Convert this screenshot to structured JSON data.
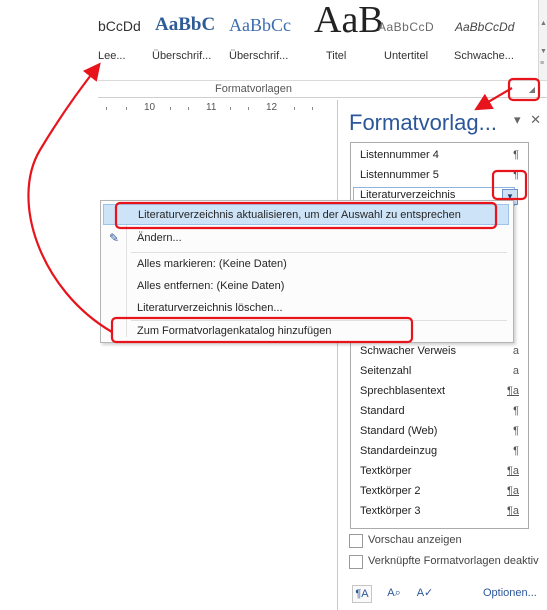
{
  "ribbon": {
    "styles": [
      {
        "preview": "bCcDd",
        "label": "Lee..."
      },
      {
        "preview": "AaBbC",
        "label": "Überschrif..."
      },
      {
        "preview": "AaBbCc",
        "label": "Überschrif..."
      },
      {
        "preview": "AaB",
        "label": "Titel"
      },
      {
        "preview": "AaBbCcD",
        "label": "Untertitel"
      },
      {
        "preview": "AaBbCcDd",
        "label": "Schwache..."
      }
    ],
    "group_label": "Formatvorlagen"
  },
  "ruler": {
    "ticks": [
      "10",
      "11",
      "12"
    ]
  },
  "pane": {
    "title": "Formatvorlag...",
    "styles": [
      {
        "name": "Listennummer 4",
        "mark": "¶"
      },
      {
        "name": "Listennummer 5",
        "mark": "¶"
      },
      {
        "name": "Literaturverzeichnis",
        "mark": ""
      },
      {
        "name": "Schwacher Verweis",
        "mark": "a"
      },
      {
        "name": "Seitenzahl",
        "mark": "a"
      },
      {
        "name": "Sprechblasentext",
        "mark": "¶a"
      },
      {
        "name": "Standard",
        "mark": "¶"
      },
      {
        "name": "Standard (Web)",
        "mark": "¶"
      },
      {
        "name": "Standardeinzug",
        "mark": "¶"
      },
      {
        "name": "Textkörper",
        "mark": "¶a"
      },
      {
        "name": "Textkörper 2",
        "mark": "¶a"
      },
      {
        "name": "Textkörper 3",
        "mark": "¶a"
      }
    ],
    "checkboxes": [
      "Vorschau anzeigen",
      "Verknüpfte Formatvorlagen deaktiv"
    ],
    "options_label": "Optionen..."
  },
  "context_menu": {
    "items": [
      "Literaturverzeichnis aktualisieren, um der Auswahl zu entsprechen",
      "Ändern...",
      "Alles markieren: (Keine Daten)",
      "Alles entfernen: (Keine Daten)",
      "Literaturverzeichnis löschen...",
      "Zum Formatvorlagenkatalog hinzufügen"
    ]
  },
  "annotation_color": "#e8141b"
}
